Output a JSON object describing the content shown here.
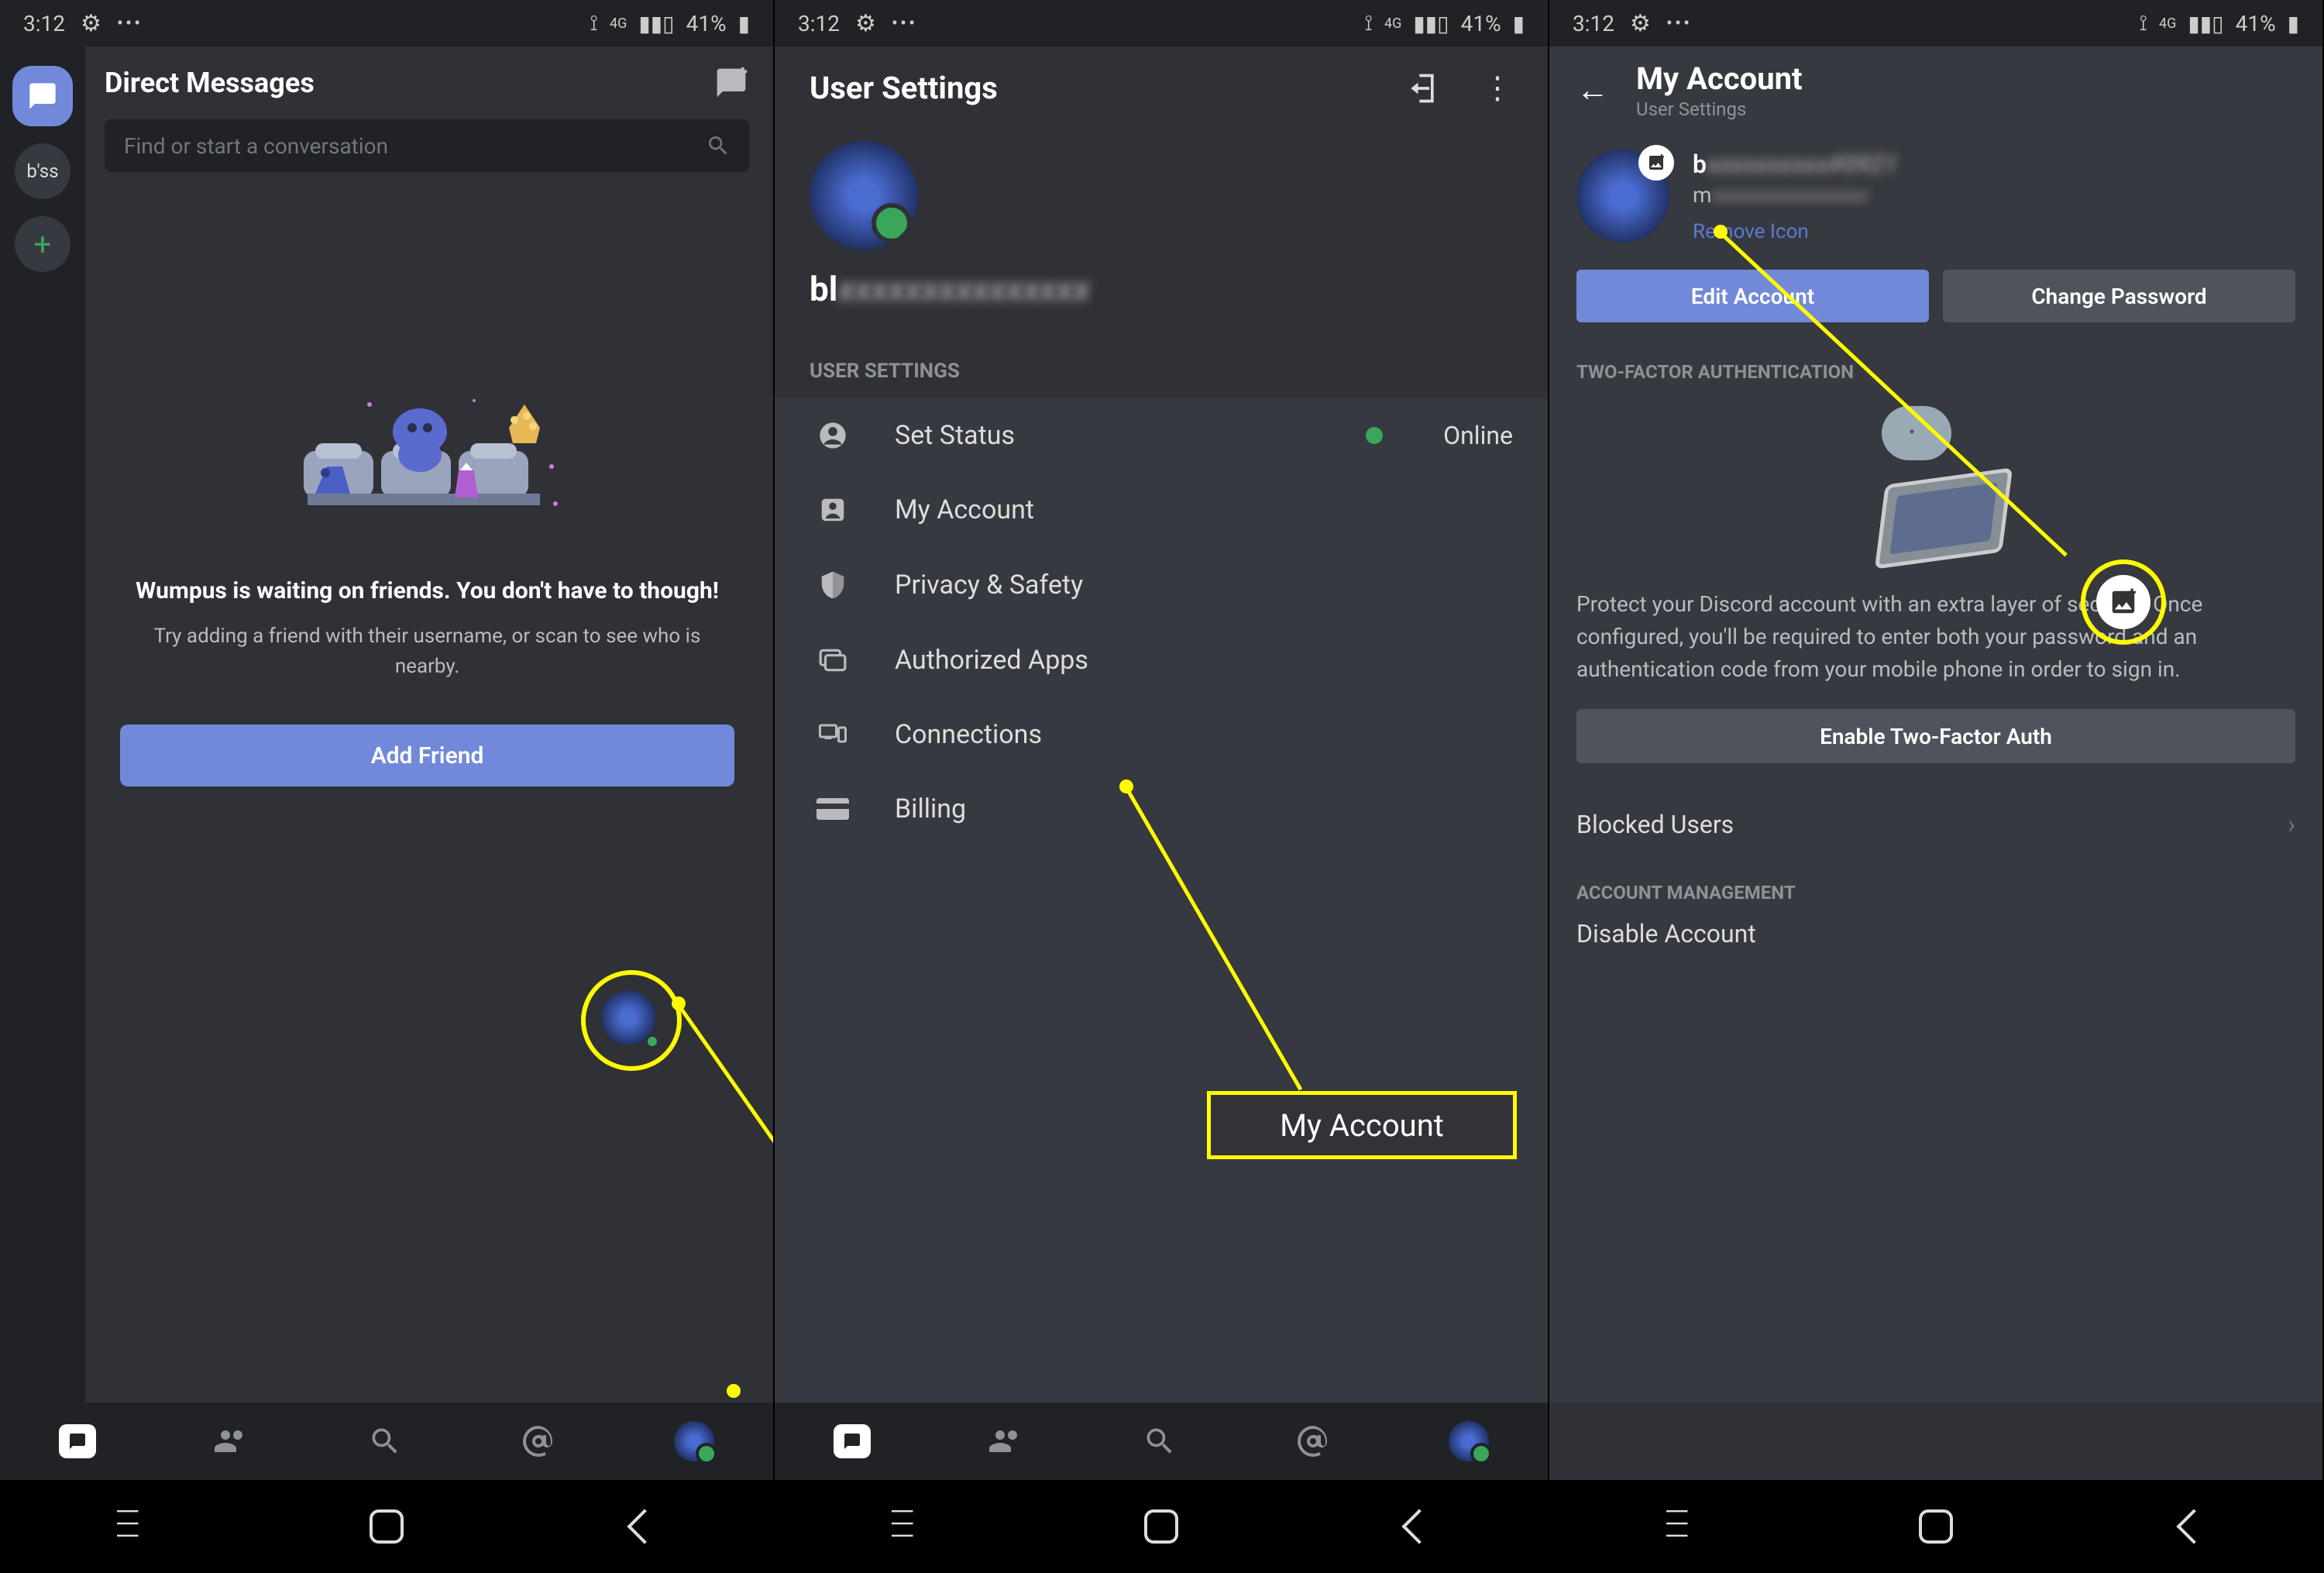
{
  "status": {
    "time": "3:12",
    "battery": "41%",
    "carrier": "4G"
  },
  "screen1": {
    "title": "Direct Messages",
    "search_placeholder": "Find or start a conversation",
    "empty_title": "Wumpus is waiting on friends. You don't have to though!",
    "empty_sub": "Try adding a friend with their username, or scan to see who is nearby.",
    "add_friend": "Add Friend",
    "server_label": "b'ss"
  },
  "screen2": {
    "title": "User Settings",
    "username_prefix": "bl",
    "section": "USER SETTINGS",
    "rows": {
      "set_status": "Set Status",
      "online": "Online",
      "my_account": "My Account",
      "privacy": "Privacy & Safety",
      "authorized": "Authorized Apps",
      "connections": "Connections",
      "billing": "Billing"
    },
    "highlight_label": "My Account"
  },
  "screen3": {
    "title": "My Account",
    "subtitle": "User Settings",
    "username": "b",
    "email": "m",
    "remove_icon": "Remove Icon",
    "edit": "Edit Account",
    "change_pw": "Change Password",
    "tfa_header": "TWO-FACTOR AUTHENTICATION",
    "tfa_desc": "Protect your Discord account with an extra layer of security. Once configured, you'll be required to enter both your password and an authentication code from your mobile phone in order to sign in.",
    "enable_tfa": "Enable Two-Factor Auth",
    "blocked": "Blocked Users",
    "acct_mgmt": "ACCOUNT MANAGEMENT",
    "disable": "Disable Account"
  }
}
